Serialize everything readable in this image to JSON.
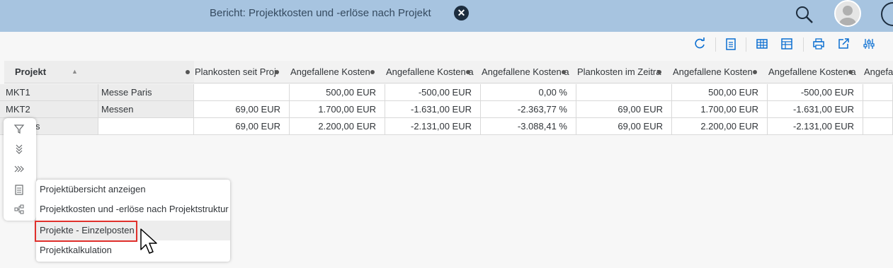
{
  "shell": {
    "title": "Bericht: Projektkosten und -erlöse nach Projekt",
    "icons": [
      "close-icon",
      "search-icon",
      "avatar",
      "help-icon"
    ]
  },
  "toolbar": {
    "icons": [
      "refresh-icon",
      "clipboard-icon",
      "table-icon",
      "table-settings-icon",
      "print-icon",
      "export-icon",
      "settings-icon"
    ]
  },
  "table": {
    "project_header": "Projekt",
    "columns": [
      "Plankosten seit Proj",
      "Angefallene Kosten",
      "Angefallene Kosten a",
      "Angefallene Kosten a",
      "Plankosten im Zeitra",
      "Angefallene Kosten",
      "Angefallene Kosten a",
      "Angefal"
    ],
    "rows": [
      {
        "id": "MKT1",
        "name": "Messe Paris",
        "values": [
          "",
          "500,00 EUR",
          "-500,00 EUR",
          "0,00 %",
          "",
          "500,00 EUR",
          "-500,00 EUR",
          ""
        ]
      },
      {
        "id": "MKT2",
        "name": "Messen",
        "values": [
          "69,00 EUR",
          "1.700,00 EUR",
          "-1.631,00 EUR",
          "-2.363,77 %",
          "69,00 EUR",
          "1.700,00 EUR",
          "-1.631,00 EUR",
          ""
        ]
      },
      {
        "id": "s",
        "name": "",
        "values": [
          "69,00 EUR",
          "2.200,00 EUR",
          "-2.131,00 EUR",
          "-3.088,41 %",
          "69,00 EUR",
          "2.200,00 EUR",
          "-2.131,00 EUR",
          ""
        ]
      }
    ]
  },
  "sidepanel": {
    "icons": [
      "filter-icon",
      "expand-down-icon",
      "expand-right-icon",
      "clipboard-icon",
      "hierarchy-icon"
    ]
  },
  "menu": {
    "items": [
      "Projektübersicht anzeigen",
      "Projektkosten und -erlöse nach Projektstruktur",
      "Projekte - Einzelposten",
      "Projektkalkulation"
    ]
  },
  "colors": {
    "shellbar": "#a7c4e0",
    "highlight": "#e0302c"
  }
}
